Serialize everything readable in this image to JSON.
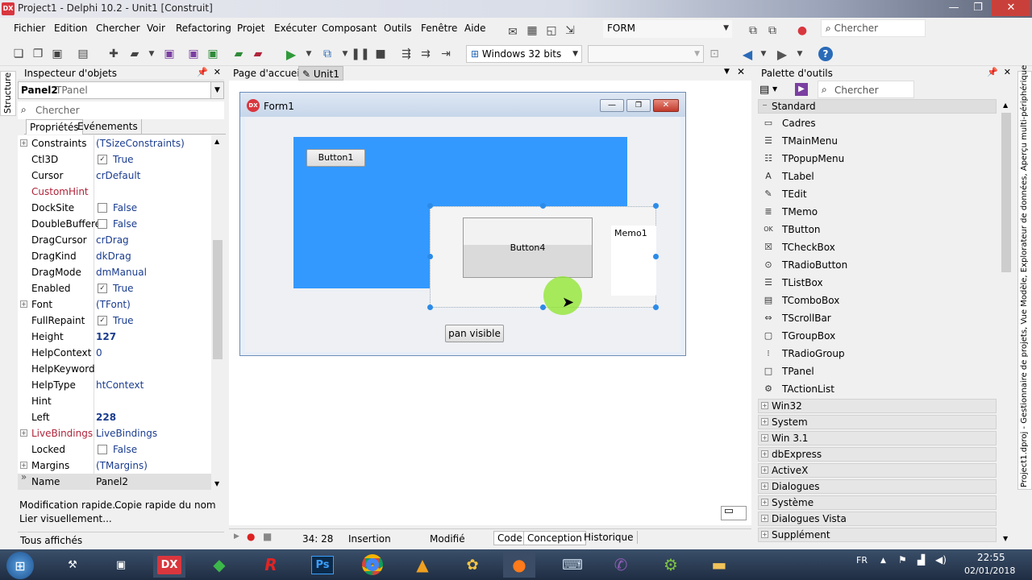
{
  "window": {
    "title": "Project1 - Delphi 10.2 - Unit1 [Construit]",
    "logo": "DX"
  },
  "menu": [
    "Fichier",
    "Edition",
    "Chercher",
    "Voir",
    "Refactoring",
    "Projet",
    "Exécuter",
    "Composant",
    "Outils",
    "Fenêtre",
    "Aide"
  ],
  "toolbar": {
    "form_combo": "FORM",
    "search_placeholder": "Chercher",
    "platform": "Windows 32 bits",
    "config": ""
  },
  "inspector": {
    "title": "Inspecteur d'objets",
    "selected_name": "Panel2",
    "selected_type": "TPanel",
    "search_placeholder": "Chercher",
    "tabs": [
      "Propriétés",
      "Evénements"
    ],
    "properties": [
      {
        "name": "Constraints",
        "value": "(TSizeConstraints)",
        "expand": "+"
      },
      {
        "name": "Ctl3D",
        "value": "True",
        "check": "✓"
      },
      {
        "name": "Cursor",
        "value": "crDefault"
      },
      {
        "name": "CustomHint",
        "value": "",
        "red": true
      },
      {
        "name": "DockSite",
        "value": "False",
        "check": " "
      },
      {
        "name": "DoubleBuffere",
        "value": "False",
        "check": " "
      },
      {
        "name": "DragCursor",
        "value": "crDrag"
      },
      {
        "name": "DragKind",
        "value": "dkDrag"
      },
      {
        "name": "DragMode",
        "value": "dmManual"
      },
      {
        "name": "Enabled",
        "value": "True",
        "check": "✓"
      },
      {
        "name": "Font",
        "value": "(TFont)",
        "expand": "+"
      },
      {
        "name": "FullRepaint",
        "value": "True",
        "check": "✓"
      },
      {
        "name": "Height",
        "value": "127",
        "bold": true
      },
      {
        "name": "HelpContext",
        "value": "0"
      },
      {
        "name": "HelpKeyword",
        "value": ""
      },
      {
        "name": "HelpType",
        "value": "htContext"
      },
      {
        "name": "Hint",
        "value": ""
      },
      {
        "name": "Left",
        "value": "228",
        "bold": true
      },
      {
        "name": "LiveBindings",
        "value": "LiveBindings",
        "expand": "+",
        "red": true
      },
      {
        "name": "Locked",
        "value": "False",
        "check": " "
      },
      {
        "name": "Margins",
        "value": "(TMargins)",
        "expand": "+"
      },
      {
        "name": "Name",
        "value": "Panel2",
        "expand": "»",
        "selected": true
      }
    ],
    "quick_edit": "Modification rapide...",
    "quick_copy": "Copie rapide du nom",
    "live_link": "Lier visuellement...",
    "footer": "Tous affichés"
  },
  "structure_tab": "Structure",
  "designer": {
    "tabs": [
      "Page d'accueil",
      "Unit1"
    ],
    "form_title": "Form1",
    "form_logo": "DX",
    "button1": "Button1",
    "button4": "Button4",
    "memo": "Memo1",
    "pan_button": "pan visible",
    "status": {
      "pos": "34:  28",
      "mode": "Insertion",
      "modified": "Modifié"
    },
    "bottom_tabs": [
      "Code",
      "Conception",
      "Historique"
    ],
    "panel_color": "#3399ff"
  },
  "palette": {
    "title": "Palette d'outils",
    "search_placeholder": "Chercher",
    "open_category": "Standard",
    "items": [
      {
        "icon": "frame-icon",
        "glyph": "▭",
        "label": "Cadres"
      },
      {
        "icon": "main-menu-icon",
        "glyph": "☰",
        "label": "TMainMenu"
      },
      {
        "icon": "popup-menu-icon",
        "glyph": "☷",
        "label": "TPopupMenu"
      },
      {
        "icon": "label-icon",
        "glyph": "A",
        "label": "TLabel"
      },
      {
        "icon": "edit-icon",
        "glyph": "✎",
        "label": "TEdit"
      },
      {
        "icon": "memo-icon",
        "glyph": "≣",
        "label": "TMemo"
      },
      {
        "icon": "button-icon",
        "glyph": "OK",
        "label": "TButton"
      },
      {
        "icon": "checkbox-icon",
        "glyph": "☒",
        "label": "TCheckBox"
      },
      {
        "icon": "radio-button-icon",
        "glyph": "⊙",
        "label": "TRadioButton"
      },
      {
        "icon": "listbox-icon",
        "glyph": "☰",
        "label": "TListBox"
      },
      {
        "icon": "combobox-icon",
        "glyph": "▤",
        "label": "TComboBox"
      },
      {
        "icon": "scrollbar-icon",
        "glyph": "⇔",
        "label": "TScrollBar"
      },
      {
        "icon": "groupbox-icon",
        "glyph": "▢",
        "label": "TGroupBox"
      },
      {
        "icon": "radio-group-icon",
        "glyph": "⁝",
        "label": "TRadioGroup"
      },
      {
        "icon": "panel-icon",
        "glyph": "□",
        "label": "TPanel"
      },
      {
        "icon": "action-list-icon",
        "glyph": "⚙",
        "label": "TActionList"
      }
    ],
    "categories": [
      "Win32",
      "System",
      "Win 3.1",
      "dbExpress",
      "ActiveX",
      "Dialogues",
      "Système",
      "Dialogues Vista",
      "Supplément"
    ]
  },
  "right_sidebar": "Project1.dproj - Gestionnaire de projets, Vue Modèle, Explorateur de données, Aperçu multi-périphérique",
  "taskbar": {
    "lang": "FR",
    "time": "22:55",
    "date": "02/01/2018",
    "dx_label": "DX",
    "ps_label": "Ps"
  }
}
